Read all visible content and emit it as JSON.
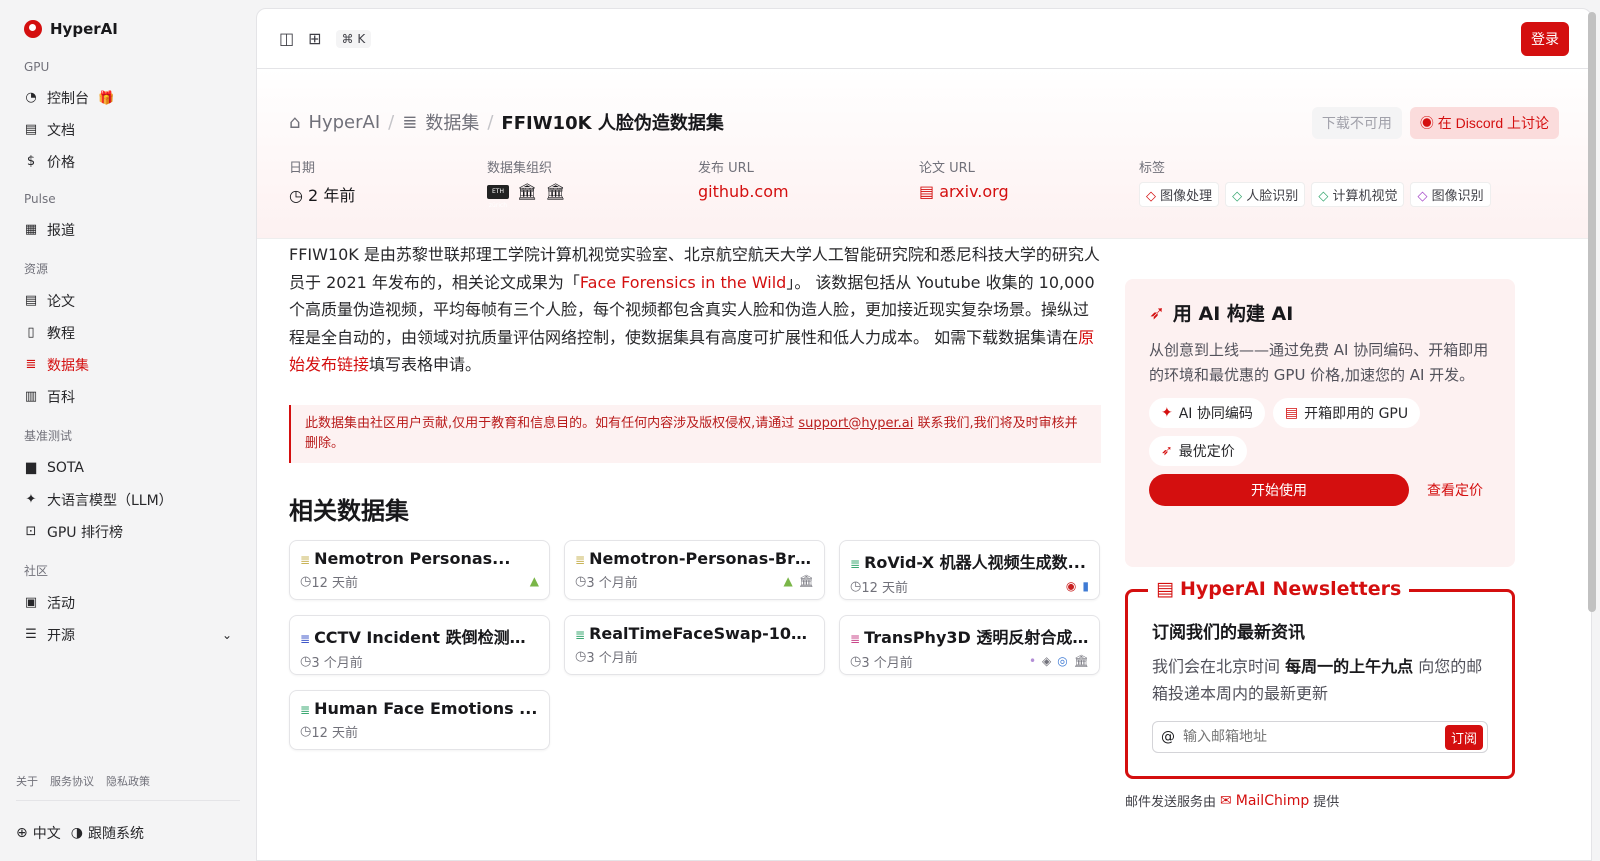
{
  "brand": "HyperAI",
  "sidebar": {
    "groups": [
      {
        "label": "GPU",
        "items": [
          {
            "label": "控制台",
            "icon": "gauge-icon"
          },
          {
            "label": "文档",
            "icon": "doc-icon"
          },
          {
            "label": "价格",
            "icon": "dollar-icon"
          }
        ]
      },
      {
        "label": "Pulse",
        "items": [
          {
            "label": "报道",
            "icon": "news-icon"
          }
        ]
      },
      {
        "label": "资源",
        "items": [
          {
            "label": "论文",
            "icon": "paper-icon"
          },
          {
            "label": "教程",
            "icon": "book-icon"
          },
          {
            "label": "数据集",
            "icon": "database-icon"
          },
          {
            "label": "百科",
            "icon": "wiki-icon"
          }
        ]
      },
      {
        "label": "基准测试",
        "items": [
          {
            "label": "SOTA",
            "icon": "chart-icon"
          },
          {
            "label": "大语言模型（LLM）",
            "icon": "sparkle-icon"
          },
          {
            "label": "GPU 排行榜",
            "icon": "chip-icon"
          }
        ]
      },
      {
        "label": "社区",
        "items": [
          {
            "label": "活动",
            "icon": "calendar-icon"
          },
          {
            "label": "开源",
            "icon": "list-icon"
          }
        ]
      }
    ],
    "footer": [
      "关于",
      "服务协议",
      "隐私政策"
    ],
    "language": "中文",
    "theme": "跟随系统"
  },
  "topbar": {
    "shortcut": "⌘ K",
    "login": "登录"
  },
  "breadcrumb": {
    "home": "HyperAI",
    "section": "数据集",
    "current": "FFIW10K 人脸伪造数据集"
  },
  "hero_actions": {
    "download": "下载不可用",
    "discord": "在 Discord 上讨论"
  },
  "meta": {
    "date_label": "日期",
    "date_value": "2 年前",
    "org_label": "数据集组织",
    "org_badge": "ETH zürich",
    "url_label": "发布 URL",
    "url_value": "github.com",
    "paper_label": "论文 URL",
    "paper_value": "arxiv.org",
    "tags_label": "标签",
    "tags": [
      "图像处理",
      "人脸识别",
      "计算机视觉",
      "图像识别"
    ]
  },
  "description": {
    "p1": "FFIW10K 是由苏黎世联邦理工学院计算机视觉实验室、北京航空航天大学人工智能研究院和悉尼科技大学的研究人员于 2021 年发布的，相关论文成果为「",
    "link1": "Face Forensics in the Wild",
    "p2": "」。 该数据包括从 Youtube 收集的 10,000 个高质量伪造视频，平均每帧有三个人脸，每个视频都包含真实人脸和伪造人脸，更加接近现实复杂场景。操纵过程是全自动的，由领域对抗质量评估网络控制，使数据集具有高度可扩展性和低人力成本。 如需下载数据集请在",
    "link2": "原始发布链接",
    "p3": "填写表格申请。"
  },
  "notice": {
    "text": "此数据集由社区用户贡献,仅用于教育和信息目的。如有任何内容涉及版权侵权,请通过 ",
    "email": "support@hyper.ai",
    "tail": " 联系我们,我们将及时审核并删除。"
  },
  "related": {
    "title": "相关数据集",
    "items": [
      {
        "title": "Nemotron Personas...",
        "time": "12 天前",
        "color": "#c9b458"
      },
      {
        "title": "Nemotron-Personas-Bra...",
        "time": "3 个月前",
        "color": "#c9b458"
      },
      {
        "title": "RoVid-X 机器人视频生成数...",
        "time": "12 天前",
        "color": "#3aa872"
      },
      {
        "title": "CCTV Incident 跌倒检测数...",
        "time": "3 个月前",
        "color": "#3f57c9"
      },
      {
        "title": "RealTimeFaceSwap-10k ...",
        "time": "3 个月前",
        "color": "#3aa872"
      },
      {
        "title": "TransPhy3D 透明反射合成...",
        "time": "3 个月前",
        "color": "#c9468a"
      },
      {
        "title": "Human Face Emotions ...",
        "time": "12 天前",
        "color": "#3aa872"
      }
    ]
  },
  "promo": {
    "title": "用 AI 构建 AI",
    "text": "从创意到上线——通过免费 AI 协同编码、开箱即用的环境和最优惠的 GPU 价格,加速您的 AI 开发。",
    "chips": [
      "AI 协同编码",
      "开箱即用的 GPU",
      "最优定价"
    ],
    "start": "开始使用",
    "pricing": "查看定价"
  },
  "newsletter": {
    "title": "HyperAI Newsletters",
    "heading": "订阅我们的最新资讯",
    "text1": "我们会在北京时间 ",
    "bold": "每周一的上午九点",
    "text2": " 向您的邮箱投递本周内的最新更新",
    "placeholder": "输入邮箱地址",
    "button": "订阅",
    "provider_pre": "邮件发送服务由",
    "provider": "MailChimp",
    "provider_post": "提供"
  },
  "colors": {
    "accent": "#d40f0f",
    "hero_bg": "#fdf1f1"
  }
}
